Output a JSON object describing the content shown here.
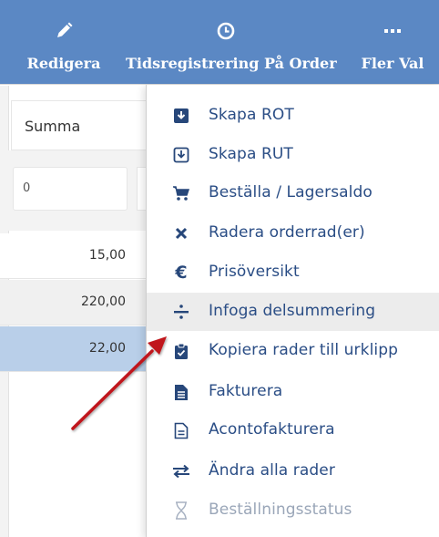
{
  "toolbar": {
    "edit_label": "Redigera",
    "time_label": "Tidsregistrering På Order",
    "more_label": "Fler Val",
    "edit_icon": "pencil-icon",
    "time_icon": "clock-icon",
    "more_icon": "ellipsis-icon",
    "background": "#5b88c4"
  },
  "table": {
    "column_header": "Summa",
    "filter_value": "0",
    "rows": [
      {
        "summa": "15,00"
      },
      {
        "summa": "220,00"
      },
      {
        "summa": "22,00"
      }
    ],
    "selected_row_color": "#b9cfe9"
  },
  "menu": {
    "items": [
      {
        "label": "Skapa ROT",
        "icon": "download-box-icon"
      },
      {
        "label": "Skapa RUT",
        "icon": "download-box-outline-icon"
      },
      {
        "label": "Beställa / Lagersaldo",
        "icon": "cart-icon"
      },
      {
        "label": "Radera orderrad(er)",
        "icon": "x-icon"
      },
      {
        "label": "Prisöversikt",
        "icon": "euro-icon"
      },
      {
        "label": "Infoga delsummering",
        "icon": "divide-icon"
      },
      {
        "label": "Kopiera rader till urklipp",
        "icon": "clipboard-check-icon"
      },
      {
        "label": "Fakturera",
        "icon": "document-icon"
      },
      {
        "label": "Acontofakturera",
        "icon": "document-outline-icon"
      },
      {
        "label": "Ändra alla rader",
        "icon": "swap-arrows-icon"
      },
      {
        "label": "Beställningsstatus",
        "icon": "hourglass-icon"
      }
    ],
    "active_item": "Infoga delsummering",
    "disabled_item": "Beställningsstatus",
    "text_color": "#2a4d85"
  },
  "annotation": {
    "arrow_color": "#c0121a"
  }
}
